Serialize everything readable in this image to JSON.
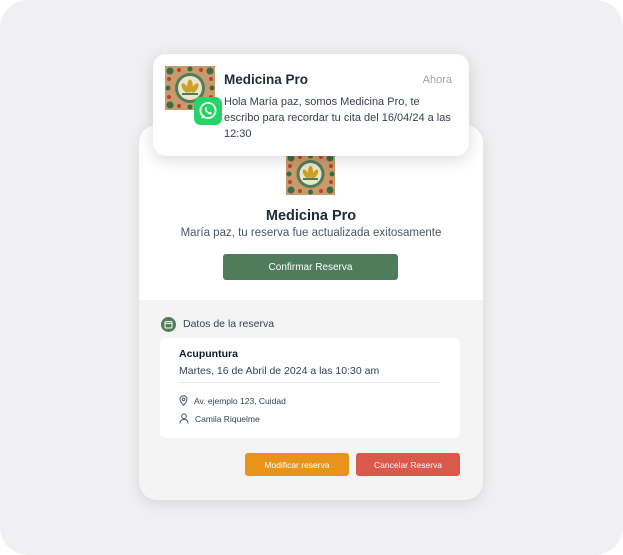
{
  "notification": {
    "app_name": "Medicina Pro",
    "time": "Ahora",
    "message": "Hola María paz, somos Medicina Pro, te escribo para recordar tu cita del 16/04/24 a las 12:30",
    "badge_icon": "whatsapp-icon"
  },
  "card": {
    "title": "Medicina Pro",
    "subtitle": "María paz, tu reserva fue actualizada exitosamente",
    "confirm_label": "Confirmar Reserva"
  },
  "reservation": {
    "section_title": "Datos de la reserva",
    "service": "Acupuntura",
    "datetime": "Martes, 16 de Abril de 2024 a las 10:30 am",
    "address": "Av. ejemplo 123, Cuidad",
    "professional": "Camila Riquelme"
  },
  "actions": {
    "modify_label": "Modificar reserva",
    "cancel_label": "Cancelar Reserva"
  },
  "colors": {
    "brand_green": "#4f7d5b",
    "modify_orange": "#e8941a",
    "cancel_red": "#d9594b",
    "whatsapp_green": "#25d366"
  }
}
